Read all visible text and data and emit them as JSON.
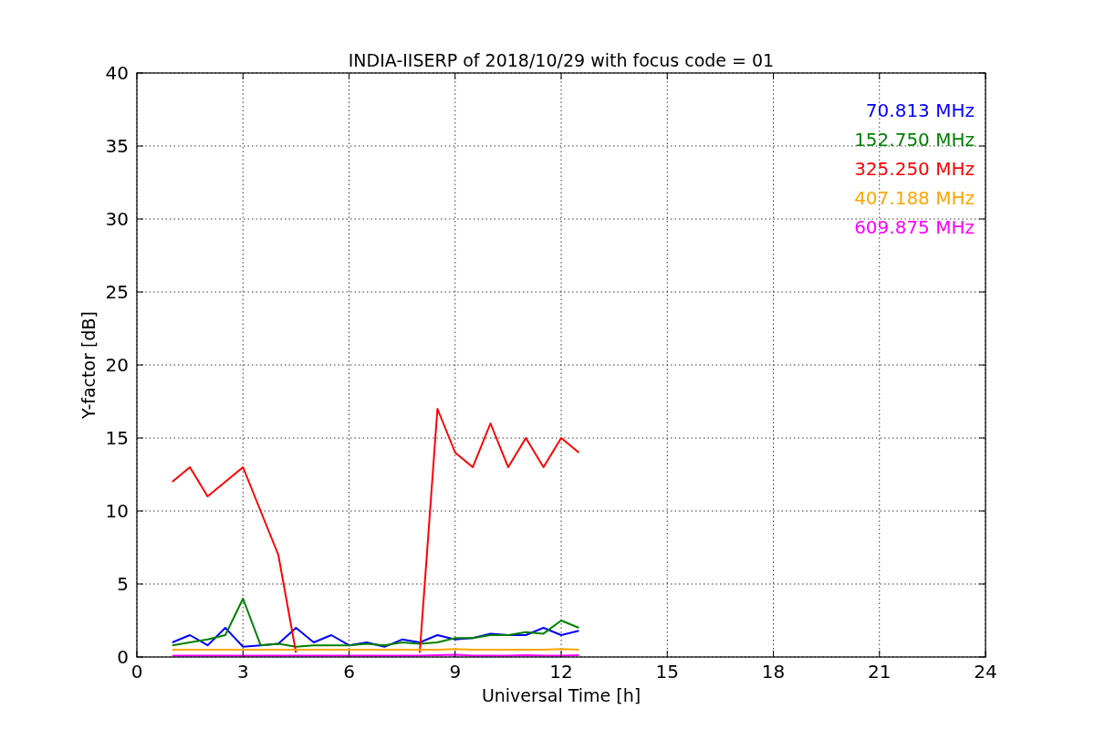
{
  "figure": {
    "chart_data": {
      "type": "line",
      "title": "INDIA-IISERP of 2018/10/29 with focus code = 01",
      "xlabel": "Universal Time [h]",
      "ylabel": "Y-factor [dB]",
      "grid": true,
      "xlim": [
        0,
        24
      ],
      "ylim": [
        0,
        40
      ],
      "xticks": [
        0,
        3,
        6,
        9,
        12,
        15,
        18,
        21,
        24
      ],
      "yticks": [
        0,
        5,
        10,
        15,
        20,
        25,
        30,
        35,
        40
      ],
      "x": [
        1,
        1.5,
        2,
        2.5,
        3,
        3.5,
        4,
        4.5,
        5,
        5.5,
        6,
        6.5,
        7,
        7.5,
        8,
        8.5,
        9,
        9.5,
        10,
        10.5,
        11,
        11.5,
        12,
        12.5
      ],
      "series": [
        {
          "name": "70.813 MHz",
          "color": "#0000ff",
          "values": [
            1,
            1.5,
            0.8,
            2,
            0.7,
            0.8,
            0.9,
            2,
            1,
            1.5,
            0.8,
            1,
            0.7,
            1.2,
            1,
            1.5,
            1.2,
            1.3,
            1.6,
            1.5,
            1.5,
            2,
            1.5,
            1.8
          ]
        },
        {
          "name": "152.750 MHz",
          "color": "#008000",
          "values": [
            0.8,
            1,
            1.2,
            1.5,
            4,
            0.8,
            0.9,
            0.7,
            0.8,
            0.8,
            0.8,
            0.9,
            0.8,
            1,
            0.9,
            1,
            1.3,
            1.3,
            1.5,
            1.5,
            1.7,
            1.6,
            2.5,
            2
          ]
        },
        {
          "name": "325.250 MHz",
          "color": "#ff0000",
          "values": [
            12,
            13,
            11,
            12,
            13,
            10,
            7,
            0.3,
            null,
            null,
            null,
            null,
            null,
            null,
            0.3,
            17,
            14,
            13,
            16,
            13,
            15,
            13,
            15,
            14
          ]
        },
        {
          "name": "407.188 MHz",
          "color": "#ffa500",
          "values": [
            0.5,
            0.5,
            0.5,
            0.5,
            0.5,
            0.5,
            0.5,
            0.5,
            0.5,
            0.5,
            0.5,
            0.5,
            0.5,
            0.5,
            0.5,
            0.5,
            0.55,
            0.5,
            0.5,
            0.5,
            0.5,
            0.5,
            0.55,
            0.5
          ]
        },
        {
          "name": "609.875 MHz",
          "color": "#ff00ff",
          "values": [
            0.1,
            0.1,
            0.1,
            0.1,
            0.1,
            0.1,
            0.1,
            0.1,
            0.1,
            0.1,
            0.1,
            0.1,
            0.1,
            0.1,
            0.1,
            0.12,
            0.15,
            0.1,
            0.1,
            0.1,
            0.12,
            0.1,
            0.1,
            0.12
          ]
        }
      ]
    }
  }
}
